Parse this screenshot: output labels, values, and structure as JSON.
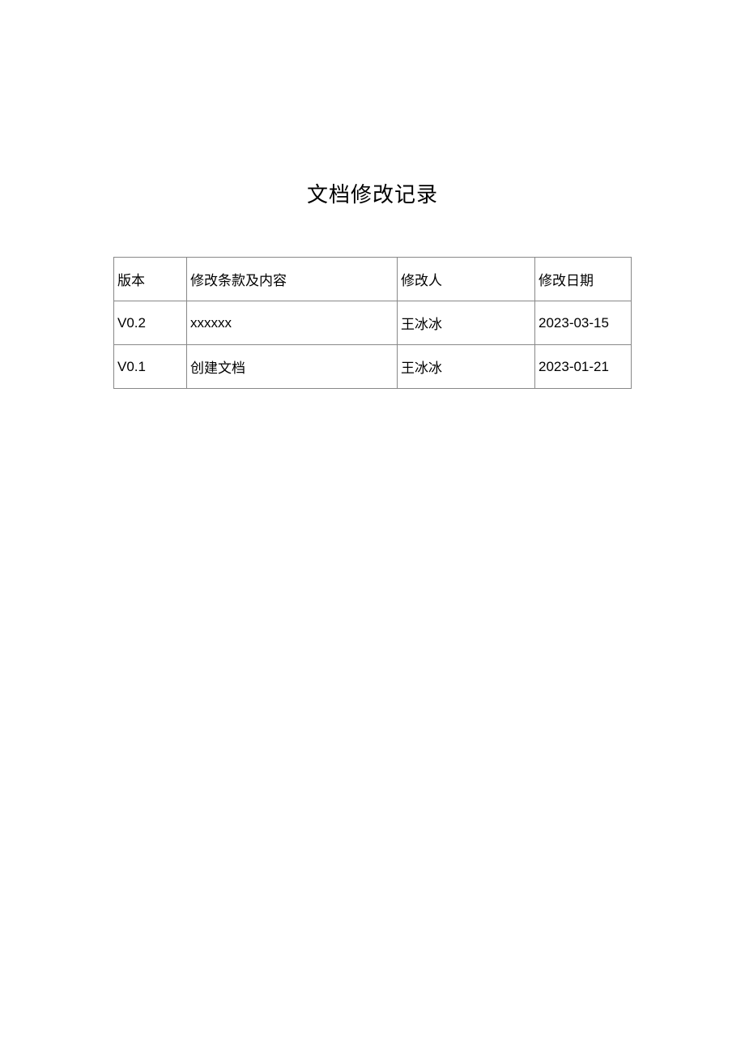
{
  "title": "文档修改记录",
  "headers": {
    "version": "版本",
    "content": "修改条款及内容",
    "author": "修改人",
    "date": "修改日期"
  },
  "rows": [
    {
      "version": "V0.2",
      "content": "xxxxxx",
      "author": "王冰冰",
      "date": "2023-03-15"
    },
    {
      "version": "V0.1",
      "content": "创建文档",
      "author": "王冰冰",
      "date": "2023-01-21"
    }
  ]
}
